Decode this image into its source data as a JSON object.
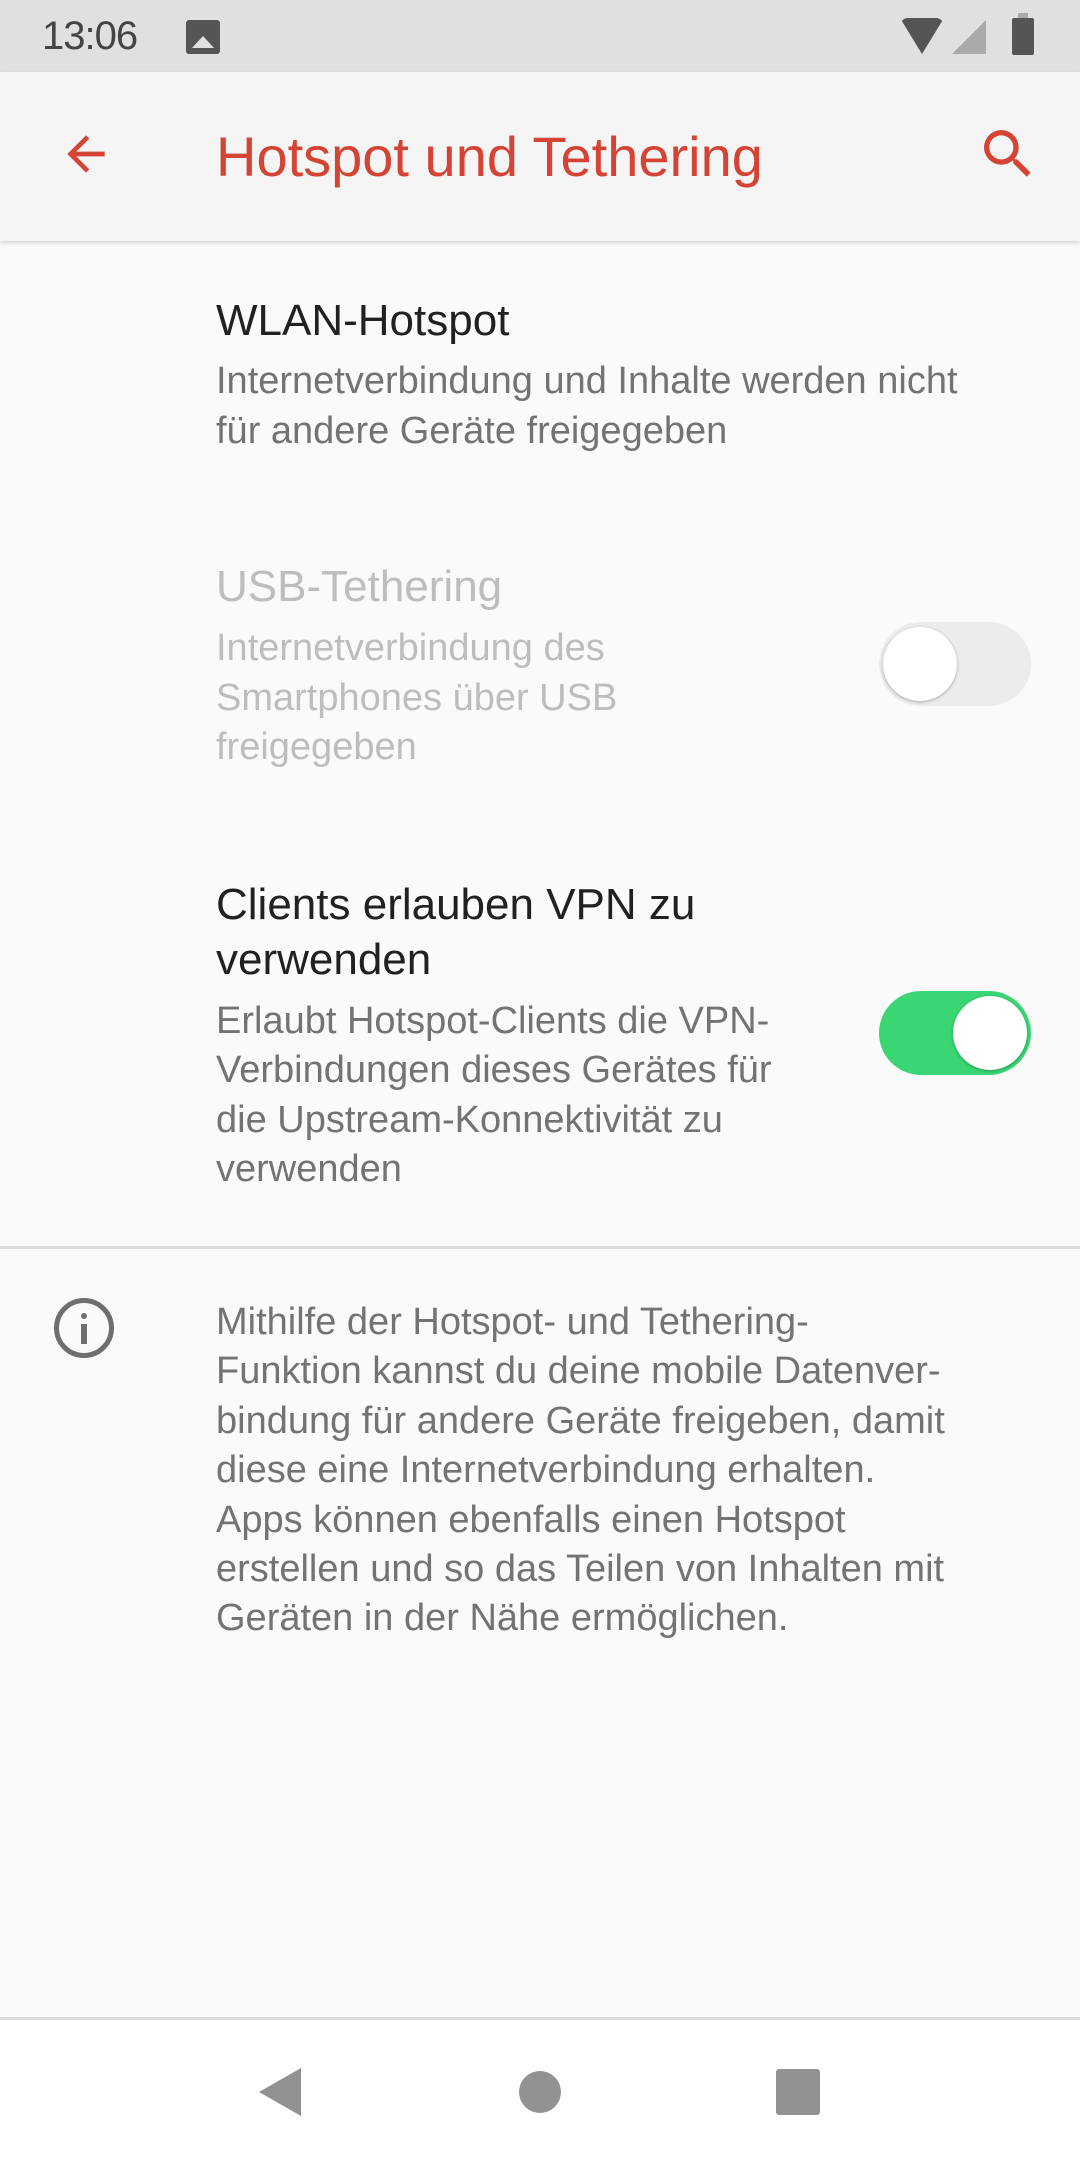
{
  "status_bar": {
    "time": "13:06",
    "icons": [
      "image-notification-icon",
      "wifi-icon",
      "cell-signal-icon",
      "battery-icon"
    ]
  },
  "app_bar": {
    "title": "Hotspot und Tethering",
    "back_icon": "arrow-left-icon",
    "search_icon": "search-icon",
    "accent_color": "#d44333"
  },
  "preferences": [
    {
      "title": "WLAN-Hotspot",
      "summary_lines": [
        "Internetverbindung und Inhalte werden nicht",
        "für andere Geräte freigegeben"
      ],
      "enabled": true
    },
    {
      "title": "USB-Tethering",
      "summary_lines": [
        "Internetverbindung des",
        "Smartphones über USB",
        "freigegeben"
      ],
      "enabled": false,
      "toggle": false
    },
    {
      "title_lines": [
        "Clients erlauben VPN zu",
        "verwenden"
      ],
      "summary_lines": [
        "Erlaubt Hotspot-Clients die VPN-",
        "Verbindungen dieses Gerätes für",
        "die Upstream-Konnektivität zu",
        "verwenden"
      ],
      "enabled": true,
      "toggle": true,
      "toggle_color": "#3ad674"
    }
  ],
  "info": {
    "icon": "info-icon",
    "lines": [
      "Mithilfe der Hotspot- und Tethering-",
      "Funktion kannst du deine mobile Datenver-",
      "bindung für andere Geräte freigeben, damit",
      "diese eine Internetverbindung erhalten.",
      "Apps können ebenfalls einen Hotspot",
      "erstellen und so das Teilen von Inhalten mit",
      "Geräten in der Nähe ermöglichen."
    ]
  },
  "nav_bar": {
    "buttons": [
      "back",
      "home",
      "recents"
    ]
  }
}
